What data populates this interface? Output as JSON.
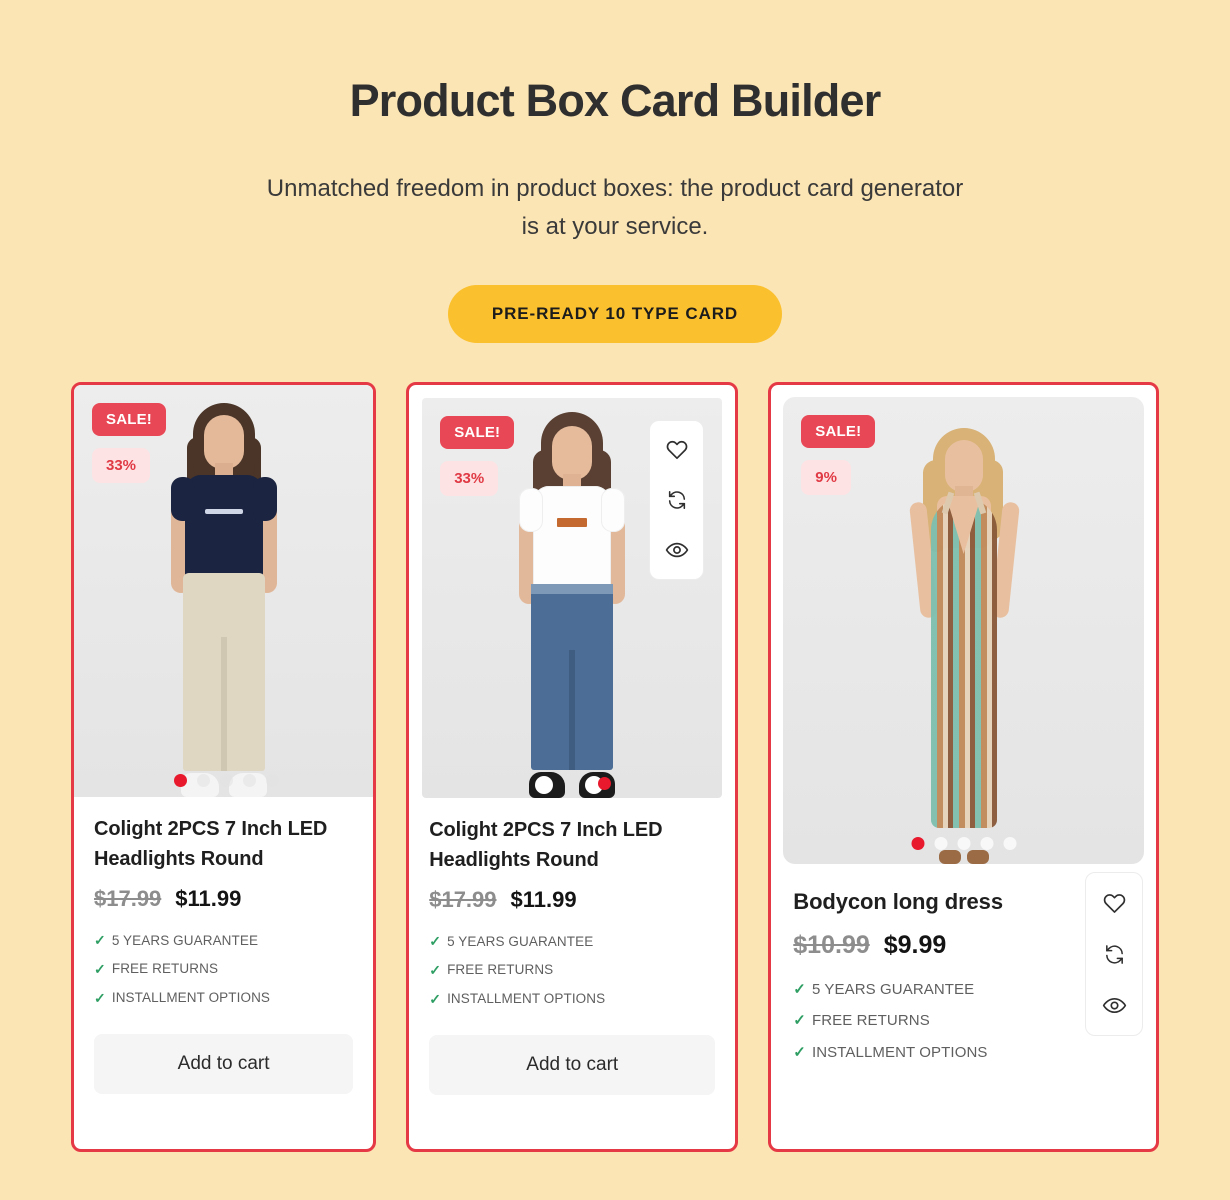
{
  "header": {
    "title": "Product Box Card Builder",
    "subtitle": "Unmatched freedom in product boxes: the product card generator is at your service.",
    "cta_label": "PRE-READY 10 TYPE CARD"
  },
  "colors": {
    "background": "#FCE5B4",
    "card_border": "#E63946",
    "sale_badge_bg": "#E84855",
    "sale_badge_text": "#FFFFFF",
    "discount_badge_bg": "#FDE3E4",
    "discount_badge_text": "#E03A45",
    "cta_bg": "#FBC02D",
    "check_green": "#2E9E63",
    "active_dot": "#E8192C",
    "add_to_cart_bg": "#F5F5F5"
  },
  "cards": [
    {
      "sale_badge": "SALE!",
      "discount_badge": "33%",
      "title": "Colight 2PCS 7 Inch LED Headlights Round",
      "old_price": "$17.99",
      "new_price": "$11.99",
      "features": [
        "5 YEARS GUARANTEE",
        "FREE RETURNS",
        "INSTALLMENT OPTIONS"
      ],
      "add_to_cart_label": "Add to cart",
      "dots": {
        "count": 5,
        "active_index": 0
      },
      "actions": []
    },
    {
      "sale_badge": "SALE!",
      "discount_badge": "33%",
      "title": "Colight 2PCS 7 Inch LED Headlights Round",
      "old_price": "$17.99",
      "new_price": "$11.99",
      "features": [
        "5 YEARS GUARANTEE",
        "FREE RETURNS",
        "INSTALLMENT OPTIONS"
      ],
      "add_to_cart_label": "Add to cart",
      "dots": {
        "count": 5,
        "active_index": 0
      },
      "actions": [
        "wishlist-heart-icon",
        "compare-refresh-icon",
        "quick-view-eye-icon"
      ]
    },
    {
      "sale_badge": "SALE!",
      "discount_badge": "9%",
      "title": "Bodycon long dress",
      "old_price": "$10.99",
      "new_price": "$9.99",
      "features": [
        "5 YEARS GUARANTEE",
        "FREE RETURNS",
        "INSTALLMENT OPTIONS"
      ],
      "add_to_cart_label": "",
      "dots": {
        "count": 5,
        "active_index": 0
      },
      "actions": [
        "wishlist-heart-icon",
        "compare-refresh-icon",
        "quick-view-eye-icon"
      ]
    }
  ]
}
